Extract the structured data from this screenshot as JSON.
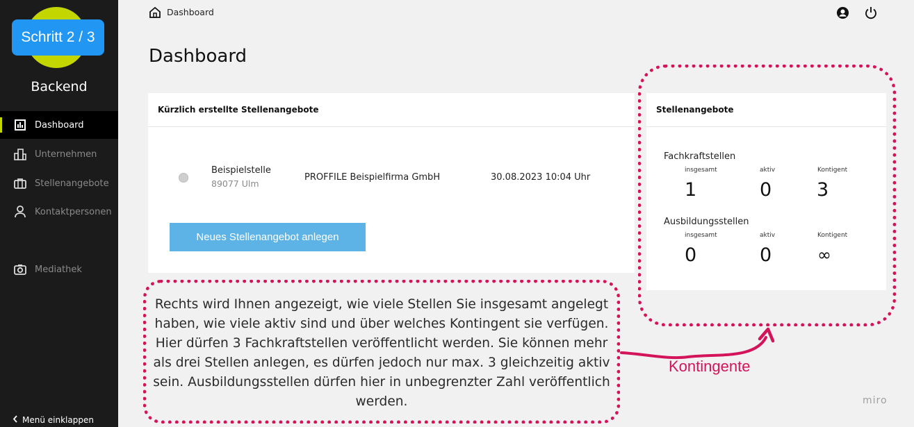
{
  "sidebar": {
    "step_badge": "Schritt 2 / 3",
    "brand": "Backend",
    "items": [
      {
        "label": "Dashboard",
        "icon": "bar-chart-icon",
        "active": true
      },
      {
        "label": "Unternehmen",
        "icon": "building-icon",
        "active": false
      },
      {
        "label": "Stellenangebote",
        "icon": "briefcase-icon",
        "active": false
      },
      {
        "label": "Kontaktpersonen",
        "icon": "person-icon",
        "active": false
      },
      {
        "label": "Mediathek",
        "icon": "camera-icon",
        "active": false
      }
    ],
    "collapse_label": "Menü einklappen"
  },
  "header": {
    "breadcrumb": "Dashboard",
    "icons": [
      "account-icon",
      "power-icon"
    ]
  },
  "page_title": "Dashboard",
  "recent_jobs": {
    "title": "Kürzlich erstellte Stellenangebote",
    "rows": [
      {
        "title": "Beispielstelle",
        "location": "89077 Ulm",
        "company": "PROFFILE Beispielfirma GmbH",
        "date": "30.08.2023 10:04 Uhr"
      }
    ],
    "new_button": "Neues Stellenangebot anlegen"
  },
  "stats": {
    "title": "Stellenangebote",
    "groups": [
      {
        "name": "Fachkraftstellen",
        "labels": [
          "insgesamt",
          "aktiv",
          "Kontigent"
        ],
        "values": [
          "1",
          "0",
          "3"
        ]
      },
      {
        "name": "Ausbildungsstellen",
        "labels": [
          "insgesamt",
          "aktiv",
          "Kontigent"
        ],
        "values": [
          "0",
          "0",
          "∞"
        ]
      }
    ]
  },
  "annotation": {
    "note": "Rechts wird Ihnen angezeigt, wie viele Stellen Sie insgesamt angelegt haben, wie viele aktiv sind und über welches Kontingent sie verfügen. Hier dürfen 3 Fachkraftstellen veröffentlicht werden. Sie können mehr als drei Stellen anlegen, es dürfen jedoch nur max. 3 gleichzeitig aktiv sein. Ausbildungsstellen dürfen hier in unbegrenzter Zahl veröffentlich werden.",
    "label": "Kontingente",
    "accent_color": "#d4145a"
  },
  "watermark": "miro",
  "colors": {
    "sidebar_bg": "#1b1b1b",
    "logo": "#c3d600",
    "step_badge": "#2196f3",
    "button": "#5eb3e6"
  }
}
